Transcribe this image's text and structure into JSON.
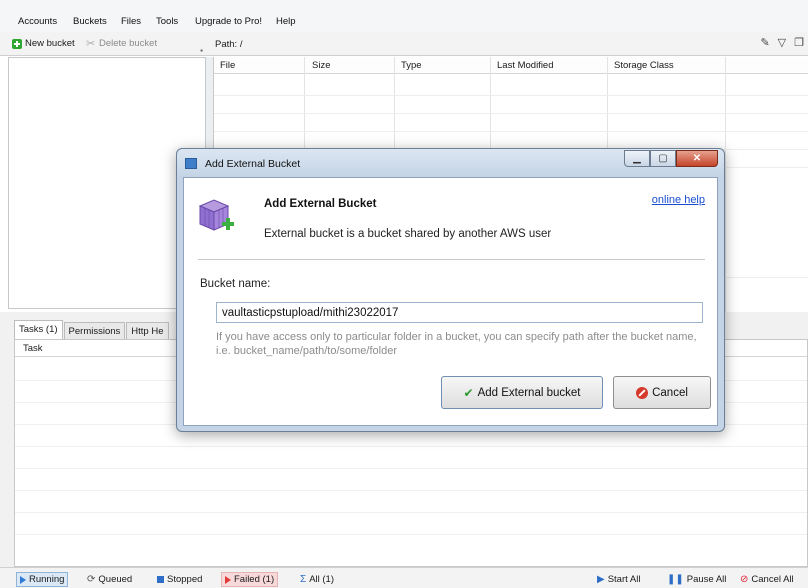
{
  "menu": [
    "Accounts",
    "Buckets",
    "Files",
    "Tools",
    "Upgrade to Pro!",
    "Help"
  ],
  "toolbar": {
    "new_bucket": "New bucket",
    "delete_bucket": "Delete bucket",
    "path_label": "Path:  /"
  },
  "file_table": {
    "columns": [
      "File",
      "Size",
      "Type",
      "Last Modified",
      "Storage Class"
    ]
  },
  "bottom_tabs": [
    "Tasks (1)",
    "Permissions",
    "Http He"
  ],
  "tasks_table": {
    "header": "Task"
  },
  "status": {
    "running": "Running",
    "queued": "Queued",
    "stopped": "Stopped",
    "failed": "Failed (1)",
    "all": "All (1)",
    "start_all": "Start All",
    "pause_all": "Pause All",
    "cancel_all": "Cancel All"
  },
  "dialog": {
    "title": "Add External Bucket",
    "heading": "Add External Bucket",
    "description": "External bucket is a bucket shared by another  AWS user",
    "help_link": "online help",
    "field_label": "Bucket name:",
    "bucket_name": "vaultasticpstupload/mithi23022017",
    "hint": "If you have access only to particular folder in a bucket, you can specify path after the bucket name, i.e. bucket_name/path/to/some/folder",
    "add_button": "Add External bucket",
    "cancel_button": "Cancel"
  },
  "colors": {
    "accent": "#1a4fd1",
    "failed": "#e23b3b",
    "dialog_frame": "#c4d4e6"
  }
}
